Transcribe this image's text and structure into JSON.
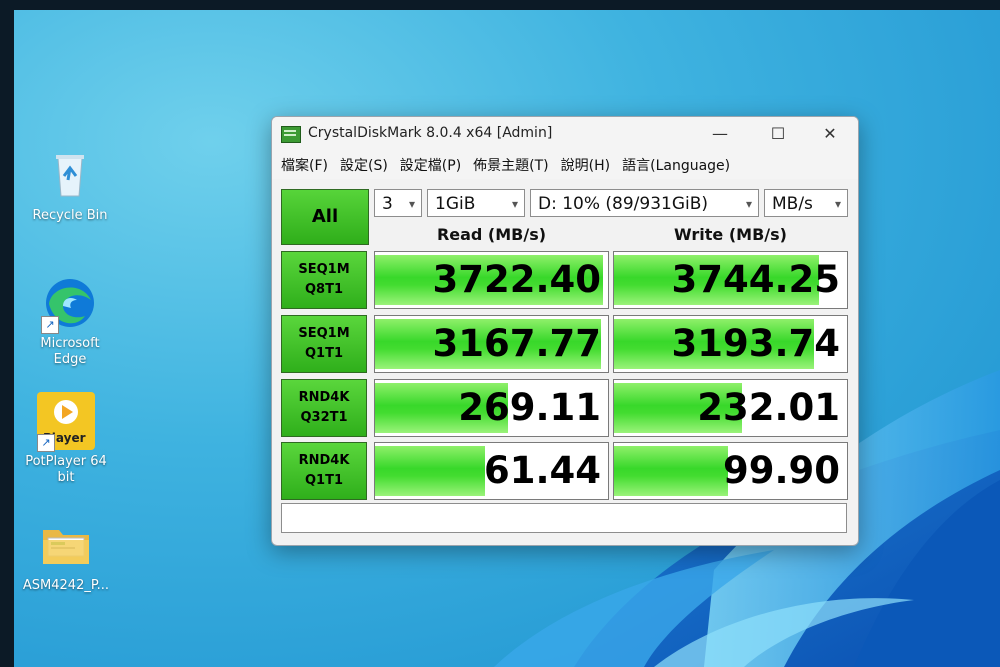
{
  "desktop": {
    "icons": [
      {
        "label": "Recycle Bin",
        "icon": "recycle-bin-icon"
      },
      {
        "label": "Microsoft Edge",
        "icon": "edge-icon"
      },
      {
        "label": "PotPlayer 64 bit",
        "icon": "potplayer-icon",
        "badge": "Player"
      },
      {
        "label": "ASM4242_P...",
        "icon": "folder-icon"
      }
    ]
  },
  "window": {
    "title": "CrystalDiskMark 8.0.4 x64 [Admin]",
    "controls": {
      "minimize": "—",
      "maximize": "☐",
      "close": "✕"
    },
    "menu": [
      "檔案(F)",
      "設定(S)",
      "設定檔(P)",
      "佈景主題(T)",
      "說明(H)",
      "語言(Language)"
    ],
    "all_button": "All",
    "count": "3",
    "size": "1GiB",
    "drive": "D: 10% (89/931GiB)",
    "unit": "MB/s",
    "read_header": "Read (MB/s)",
    "write_header": "Write (MB/s)",
    "rows": [
      {
        "line1": "SEQ1M",
        "line2": "Q8T1",
        "read": "3722.40",
        "write": "3744.25",
        "read_fill": 0.98,
        "write_fill": 0.88
      },
      {
        "line1": "SEQ1M",
        "line2": "Q1T1",
        "read": "3167.77",
        "write": "3193.74",
        "read_fill": 0.97,
        "write_fill": 0.86
      },
      {
        "line1": "RND4K",
        "line2": "Q32T1",
        "read": "269.11",
        "write": "232.01",
        "read_fill": 0.57,
        "write_fill": 0.55
      },
      {
        "line1": "RND4K",
        "line2": "Q1T1",
        "read": "61.44",
        "write": "99.90",
        "read_fill": 0.47,
        "write_fill": 0.49
      }
    ]
  },
  "colors": {
    "accent_green": "#38d82a",
    "button_green": "#2fae1a"
  }
}
